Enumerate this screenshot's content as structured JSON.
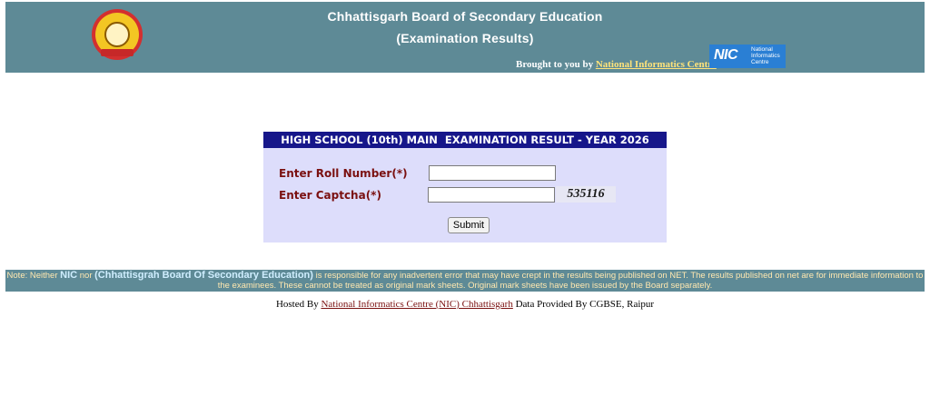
{
  "header": {
    "title_line1": "Chhattisgarh Board of Secondary Education",
    "title_line2": "(Examination Results)",
    "brought_prefix": "Brought to you by",
    "brought_link": "National Informatics Centre",
    "nic_logo_text": "NIC",
    "nic_logo_sub1": "National",
    "nic_logo_sub2": "Informatics",
    "nic_logo_sub3": "Centre"
  },
  "form": {
    "title": "HIGH SCHOOL (10th) MAIN  EXAMINATION RESULT - YEAR 2026",
    "roll_label": "Enter Roll Number(*)",
    "captcha_label": "Enter Captcha(*)",
    "roll_value": "",
    "captcha_value": "",
    "captcha_code": "535116",
    "submit_label": "Submit"
  },
  "note": {
    "prefix": "Note: Neither",
    "nic": "NIC",
    "nor": "nor",
    "board": "(Chhattisgrah Board Of Secondary Education)",
    "rest": "is responsible for any inadvertent error that may have crept in the results being published on NET. The results published on net are for immediate information to the examinees. These cannot be treated as original mark sheets. Original mark sheets have been issued by the Board separately."
  },
  "footer": {
    "hosted_prefix": "Hosted By",
    "hosted_link": "National Informatics Centre (NIC) Chhattisgarh",
    "data_text": "Data Provided By CGBSE, Raipur"
  },
  "colors": {
    "header_bg": "#5e8a96",
    "form_bg": "#ddddfb",
    "form_title_bg": "#16168a",
    "label_color": "#7a1010"
  },
  "icons": {
    "board_logo": "cgbse-emblem-icon",
    "nic_logo": "nic-logo-icon"
  }
}
